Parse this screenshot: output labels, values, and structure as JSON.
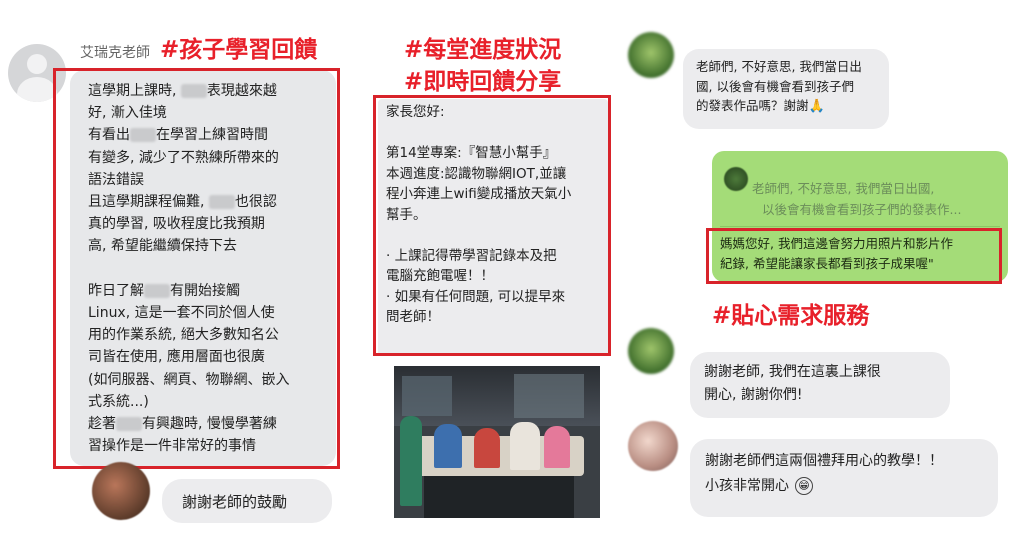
{
  "left": {
    "teacher_name": "艾瑞克老師",
    "hashtag": "#孩子學習回饋",
    "message_lines": [
      [
        "這學期上課時, ",
        "BLUR",
        "表現越來越"
      ],
      [
        "好, 漸入佳境"
      ],
      [
        "有看出",
        "BLUR",
        "在學習上練習時間"
      ],
      [
        "有變多, 減少了不熟練所帶來的"
      ],
      [
        "語法錯誤"
      ],
      [
        "且這學期課程偏難, ",
        "BLUR",
        "也很認"
      ],
      [
        "真的學習, 吸收程度比我預期"
      ],
      [
        "高, 希望能繼續保持下去"
      ],
      [
        ""
      ],
      [
        "昨日了解",
        "BLUR",
        "有開始接觸"
      ],
      [
        "Linux, 這是一套不同於個人使"
      ],
      [
        "用的作業系統, 絕大多數知名公"
      ],
      [
        "司皆在使用, 應用層面也很廣"
      ],
      [
        "(如伺服器、網頁、物聯網、嵌入"
      ],
      [
        "式系統...)"
      ],
      [
        "趁著",
        "BLUR",
        "有興趣時, 慢慢學著練"
      ],
      [
        "習操作是一件非常好的事情"
      ]
    ],
    "reply": "謝謝老師的鼓勵"
  },
  "middle": {
    "hashtag_1": "#每堂進度狀況",
    "hashtag_2": "#即時回饋分享",
    "message_lines": [
      "家長您好:",
      "",
      "第14堂專案:『智慧小幫手』",
      "本週進度:認識物聯網IOT,並讓",
      "程小奔連上wifi變成播放天氣小",
      "幫手。",
      "",
      "· 上課記得帶學習記錄本及把",
      "電腦充飽電喔！！",
      "· 如果有任何問題, 可以提早來",
      "問老師！"
    ]
  },
  "right": {
    "parent_msg_lines": [
      "老師們, 不好意思, 我們當日出",
      "國, 以後會有機會看到孩子們",
      "的發表作品嗎？謝謝"
    ],
    "quote_lines": [
      "老師們, 不好意思, 我們當日出國,",
      "以後會有機會看到孩子們的發表作..."
    ],
    "teacher_reply_lines": [
      "媽媽您好, 我們這邊會努力用照片和影片作",
      "紀錄, 希望能讓家長都看到孩子成果喔\""
    ],
    "hashtag": "#貼心需求服務",
    "thanks_1_lines": [
      "謝謝老師, 我們在這裏上課很",
      "開心, 謝謝你們!"
    ],
    "thanks_2_lines": [
      "謝謝老師們這兩個禮拜用心的教學！！",
      "小孩非常開心"
    ]
  },
  "colors": {
    "accent_red": "#d8232a",
    "bubble_gray": "#e7e8ea",
    "bubble_green": "#a4dc78"
  }
}
